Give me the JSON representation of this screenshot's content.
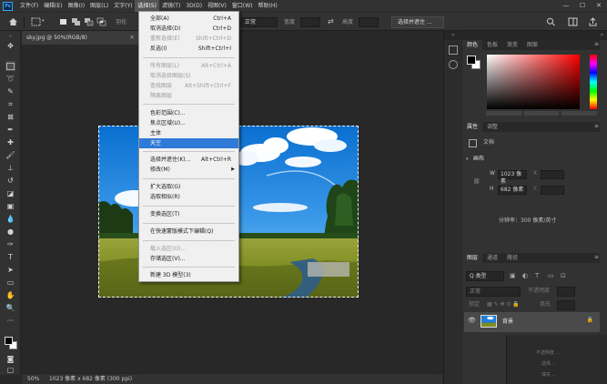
{
  "app": {
    "logo": "Ps",
    "menus": [
      "文件(F)",
      "编辑(E)",
      "图像(I)",
      "图层(L)",
      "文字(Y)",
      "选择(S)",
      "滤镜(T)",
      "3D(D)",
      "视图(V)",
      "窗口(W)",
      "帮助(H)"
    ],
    "active_menu_index": 5,
    "window_controls": [
      "—",
      "☐",
      "✕"
    ]
  },
  "options_bar": {
    "feather_label": "羽化",
    "mode_value": "正常",
    "width_label": "宽度",
    "height_label": "高度",
    "select_mask_button": "选择并遮住 ..."
  },
  "document": {
    "tab_title": "sky.jpg @ 50%(RGB/8)",
    "tab_close": "×"
  },
  "status": {
    "zoom": "50%",
    "doc_info": "1023 像素 x 682 像素 (300 ppi)"
  },
  "select_menu": {
    "items": [
      {
        "label": "全部(A)",
        "shortcut": "Ctrl+A",
        "disabled": false
      },
      {
        "label": "取消选择(D)",
        "shortcut": "Ctrl+D",
        "disabled": false
      },
      {
        "label": "重新选择(E)",
        "shortcut": "Shift+Ctrl+D",
        "disabled": true
      },
      {
        "label": "反选(I)",
        "shortcut": "Shift+Ctrl+I",
        "disabled": false
      },
      {
        "label": "所有图层(L)",
        "shortcut": "Alt+Ctrl+A",
        "disabled": true
      },
      {
        "label": "取消选择图层(S)",
        "shortcut": "",
        "disabled": true
      },
      {
        "label": "查找图层",
        "shortcut": "Alt+Shift+Ctrl+F",
        "disabled": true
      },
      {
        "label": "隔离图层",
        "shortcut": "",
        "disabled": true
      },
      {
        "label": "色彩范围(C)...",
        "shortcut": "",
        "disabled": false
      },
      {
        "label": "焦点区域(U)...",
        "shortcut": "",
        "disabled": false
      },
      {
        "label": "主体",
        "shortcut": "",
        "disabled": false
      },
      {
        "label": "天空",
        "shortcut": "",
        "disabled": false,
        "highlighted": true
      },
      {
        "label": "选择并遮住(K)...",
        "shortcut": "Alt+Ctrl+R",
        "disabled": false
      },
      {
        "label": "修改(M)",
        "shortcut": "",
        "disabled": false,
        "submenu": true
      },
      {
        "label": "扩大选取(G)",
        "shortcut": "",
        "disabled": false
      },
      {
        "label": "选取相似(R)",
        "shortcut": "",
        "disabled": false
      },
      {
        "label": "变换选区(T)",
        "shortcut": "",
        "disabled": false
      },
      {
        "label": "在快速蒙版模式下编辑(Q)",
        "shortcut": "",
        "disabled": false
      },
      {
        "label": "载入选区(O)...",
        "shortcut": "",
        "disabled": true
      },
      {
        "label": "存储选区(V)...",
        "shortcut": "",
        "disabled": false
      },
      {
        "label": "新建 3D 模型(3)",
        "shortcut": "",
        "disabled": false
      }
    ]
  },
  "panels": {
    "color_tabs": [
      "颜色",
      "色板",
      "渐变",
      "图案"
    ],
    "properties_tabs": [
      "属性",
      "调整"
    ],
    "doc_label": "文档",
    "canvas_section": "画布",
    "w_label": "W",
    "w_value": "1023 像素",
    "x_label": "X",
    "h_label": "H",
    "h_value": "682 像素",
    "y_label": "Y",
    "resolution": "分辨率：300 像素/英寸",
    "layers_tabs": [
      "图层",
      "通道",
      "路径"
    ],
    "kind_filter": "Q 类型",
    "blend_mode": "正常",
    "opacity_label": "不透明度",
    "lock_label": "锁定",
    "fill_label": "填充",
    "layer_name": "背景"
  },
  "mini_panel": {
    "rows": [
      "不透明度 ...",
      "选择...",
      "填充 ..."
    ]
  },
  "colors": {
    "accent_highlight": "#2f7ad6",
    "ui_dark": "#282828",
    "ui_panel": "#323232",
    "ps_blue": "#31a8ff"
  }
}
